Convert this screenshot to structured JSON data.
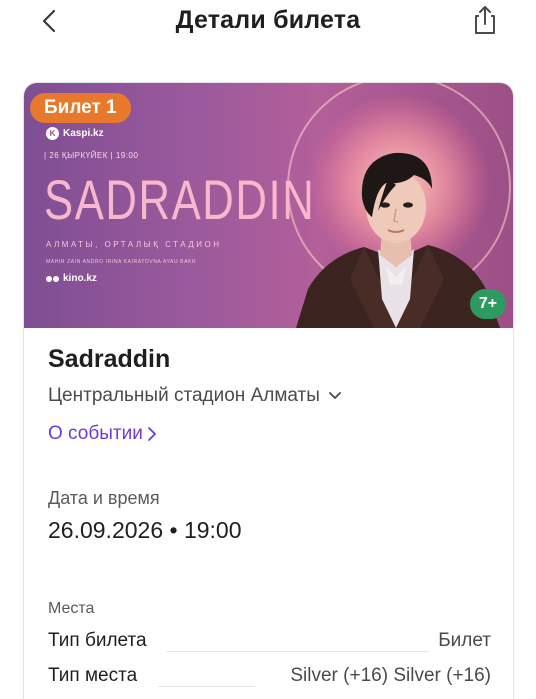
{
  "header": {
    "title": "Детали билета",
    "back_icon": "chevron-left-icon",
    "share_icon": "share-icon"
  },
  "banner": {
    "ticket_badge": "Билет 1",
    "ticket_badge_color": "#e8792c",
    "kaspi_label": "Kaspi.kz",
    "date_line": "| 26 ҚЫРКҮЙЕК | 19:00",
    "artist_title": "SADRADDIN",
    "venue_line": "АЛМАТЫ, ОРТАЛЫҚ СТАДИОН",
    "names_line": "MAHIR ZAIN ANDRO IRINA KAIRATOVNA AYAU BAKR",
    "kino_label": "kino.kz",
    "age_rating": "7+",
    "age_rating_color": "#2e9a62"
  },
  "event": {
    "name": "Sadraddin",
    "venue": "Центральный стадион Алматы",
    "about_link": "О событии",
    "link_color": "#6f3bd6"
  },
  "datetime": {
    "label": "Дата и время",
    "value": "26.09.2026 • 19:00"
  },
  "seats": {
    "label": "Места",
    "rows": [
      {
        "key": "Тип билета",
        "value": "Билет"
      },
      {
        "key": "Тип места",
        "value": "Silver (+16) Silver (+16)"
      }
    ]
  }
}
